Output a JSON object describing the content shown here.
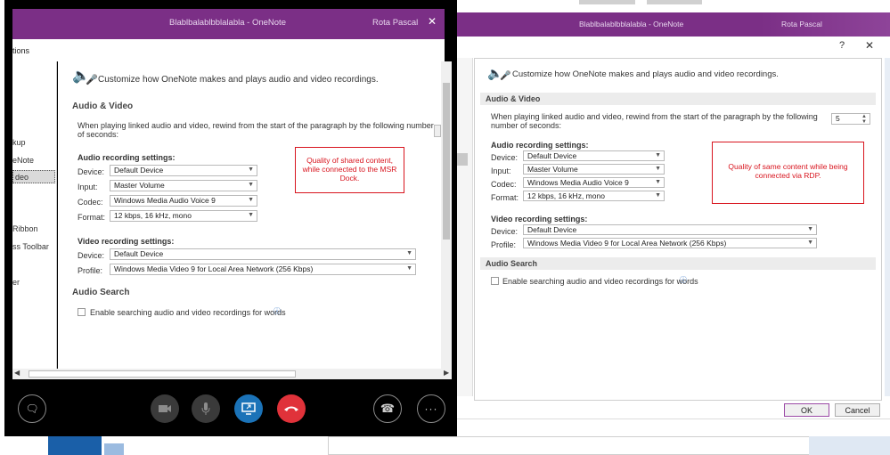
{
  "right": {
    "title": "Blablbalablbblalabla - OneNote",
    "user": "Rota Pascal",
    "dialog_q": "?",
    "dialog_close": "✕",
    "header_text": "Customize how OneNote makes and plays audio and video recordings.",
    "section_av": "Audio & Video",
    "rewind_text": "When playing linked audio and video, rewind from the start of the paragraph by the following number of seconds:",
    "rewind_value": "5",
    "audio_settings": "Audio recording settings:",
    "device_label": "Device:",
    "device_value": "Default Device",
    "input_label": "Input:",
    "input_value": "Master Volume",
    "codec_label": "Codec:",
    "codec_value": "Windows Media Audio Voice 9",
    "format_label": "Format:",
    "format_value": "12 kbps, 16 kHz, mono",
    "video_settings": "Video recording settings:",
    "vdevice_label": "Device:",
    "vdevice_value": "Default Device",
    "profile_label": "Profile:",
    "profile_value": "Windows Media Video 9 for Local Area Network (256 Kbps)",
    "section_search": "Audio Search",
    "search_checkbox": "Enable searching audio and video recordings for words",
    "annotation": "Quality of same content while being connected via RDP.",
    "ok": "OK",
    "cancel": "Cancel"
  },
  "left": {
    "title": "Blablbalablbblalabla - OneNote",
    "user": "Rota Pascal",
    "close": "✕",
    "dialog_title": "tions",
    "sidebar": [
      "kup",
      "eNote",
      "deo",
      "Ribbon",
      "ss Toolbar",
      "er"
    ],
    "header_text": "Customize how OneNote makes and plays audio and video recordings.",
    "section_av": "Audio & Video",
    "rewind_text": "When playing linked audio and video, rewind from the start of the paragraph by the following number of seconds:",
    "audio_settings": "Audio recording settings:",
    "device_label": "Device:",
    "device_value": "Default Device",
    "input_label": "Input:",
    "input_value": "Master Volume",
    "codec_label": "Codec:",
    "codec_value": "Windows Media Audio Voice 9",
    "format_label": "Format:",
    "format_value": "12 kbps, 16 kHz, mono",
    "video_settings": "Video recording settings:",
    "vdevice_label": "Device:",
    "vdevice_value": "Default Device",
    "profile_label": "Profile:",
    "profile_value": "Windows Media Video 9 for Local Area Network (256 Kbps)",
    "section_search": "Audio Search",
    "search_checkbox": "Enable searching audio and video recordings for words",
    "annotation": "Quality of shared content, while connected to the MSR Dock."
  },
  "colors": {
    "onenote_purple": "#7b2f86",
    "annotation_red": "#d8141e",
    "hangup_red": "#e0323a",
    "share_blue": "#1b73b8"
  },
  "icons": [
    "speaker-icon",
    "mic-icon",
    "chat-icon",
    "camera-icon",
    "share-screen-icon",
    "hangup-icon",
    "call-control-icon",
    "more-icon",
    "info-icon"
  ]
}
